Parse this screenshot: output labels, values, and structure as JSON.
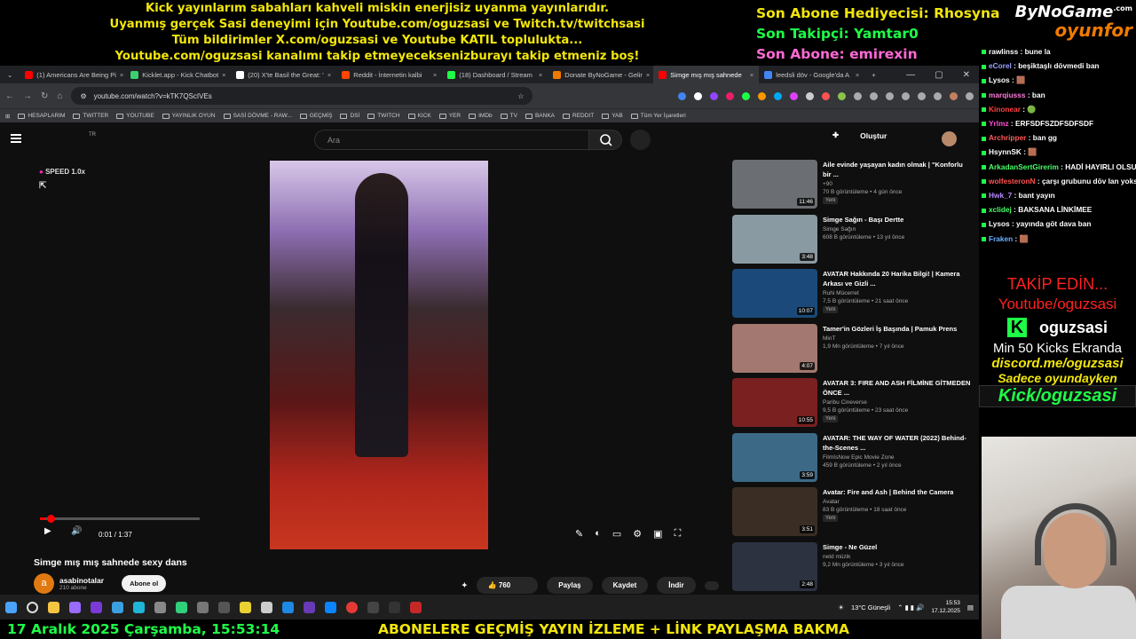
{
  "banner": {
    "line1": "Kick yayınlarım sabahları kahveli miskin enerjisiz uyanma yayınlarıdır.",
    "line2": "Uyanmış gerçek Sasi deneyimi için Youtube.com/oguzsasi ve Twitch.tv/twitchsasi",
    "line3": "Tüm bildirimler X.com/oguzsasi ve Youtube KATIL toplulukta...",
    "line4": "Youtube.com/oguzsasi kanalımı takip etmeyeceksenizburayı takip etmeniz boş!"
  },
  "stats": {
    "gift": "Son Abone Hediyecisi: Rhosyna",
    "follower": "Son Takipçi: Yamtar0",
    "subscriber": "Son Abone: emirexin"
  },
  "brand": {
    "name": "ByNoGame",
    "com": ".com",
    "sub": "oyunfor"
  },
  "tabs": [
    {
      "label": "(1) Americans Are Being Pi",
      "color": "#ff0000"
    },
    {
      "label": "Kicklet.app - Kick Chatbot",
      "color": "#3bd16f"
    },
    {
      "label": "(20) X'te Basil the Great: '",
      "color": "#ffffff"
    },
    {
      "label": "Reddit - İnternetin kalbi",
      "color": "#ff4500"
    },
    {
      "label": "(18) Dashboard / Stream",
      "color": "#1eff47"
    },
    {
      "label": "Donate ByNoGame - Gelir",
      "color": "#f07a00"
    },
    {
      "label": "Simge mış mış sahnede",
      "color": "#ff0000",
      "active": true
    },
    {
      "label": "leedsli döv - Google'da A",
      "color": "#4285f4"
    }
  ],
  "address": {
    "url": "youtube.com/watch?v=kTK7QScIVEs"
  },
  "bookmarks": [
    "HESAPLARIM",
    "TWITTER",
    "YOUTUBE",
    "YAYINLIK OYUN",
    "SASİ DÖVME - RAW...",
    "GEÇMİŞ",
    "DSİ",
    "TWITCH",
    "KICK",
    "YER",
    "IMDb",
    "TV",
    "BANKA",
    "REDDIT",
    "YAB",
    "Tüm Yer İşaretleri"
  ],
  "youtube": {
    "region": "TR",
    "search_placeholder": "Ara",
    "create_label": "Oluştur",
    "speed": "SPEED 1.0x",
    "time": "0:01 / 1:37",
    "progress": 0.01,
    "title": "Simge mış mış sahnede sexy dans",
    "channel": "asabinotalar",
    "channel_initial": "a",
    "subscribers": "210 abone",
    "subscribe_label": "Abone ol",
    "likes": "760",
    "share": "Paylaş",
    "save": "Kaydet",
    "download": "İndir"
  },
  "recommendations": [
    {
      "title": "Aile evinde yaşayan kadın olmak | \"Konforlu bir ...",
      "channel": "+90",
      "views": "70 B görüntüleme • 4 gün önce",
      "badge": "Yeni",
      "duration": "11:46",
      "color": "#6b6e72"
    },
    {
      "title": "Simge Sağın - Başı Dertte",
      "channel": "Simge Sağın",
      "views": "608 B görüntüleme • 13 yıl önce",
      "badge": "",
      "duration": "3:48",
      "color": "#8a9aa2"
    },
    {
      "title": "AVATAR Hakkında 20 Harika Bilgi! | Kamera Arkası ve Gizli ...",
      "channel": "Ruhi Mücerret",
      "views": "7,5 B görüntüleme • 21 saat önce",
      "badge": "Yeni",
      "duration": "10:07",
      "color": "#1b4a7a"
    },
    {
      "title": "Tamer'in Gözleri İş Başında | Pamuk Prens",
      "channel": "MinT",
      "views": "1,9 Mn görüntüleme • 7 yıl önce",
      "badge": "",
      "duration": "4:07",
      "color": "#a37870"
    },
    {
      "title": "AVATAR 3: FIRE AND ASH FİLMİNE GİTMEDEN ÖNCE ...",
      "channel": "Paribu Cineverse",
      "views": "9,5 B görüntüleme • 23 saat önce",
      "badge": "Yeni",
      "duration": "10:55",
      "color": "#7a2020"
    },
    {
      "title": "AVATAR: THE WAY OF WATER (2022) Behind-the-Scenes ...",
      "channel": "FilmIsNow Epic Movie Zone",
      "views": "459 B görüntüleme • 2 yıl önce",
      "badge": "",
      "duration": "3:59",
      "color": "#3c6a86"
    },
    {
      "title": "Avatar: Fire and Ash | Behind the Camera",
      "channel": "Avatar",
      "views": "83 B görüntüleme • 18 saat önce",
      "badge": "Yeni",
      "duration": "3:51",
      "color": "#3a2e24"
    },
    {
      "title": "Simge - Ne Güzel",
      "channel": "netd müzik",
      "views": "9,2 Mn görüntüleme • 3 yıl önce",
      "badge": "",
      "duration": "2:48",
      "color": "#2c3240"
    }
  ],
  "chat": [
    {
      "user": "rawlinss",
      "msg": "bune la",
      "color": "#ffffff"
    },
    {
      "user": "eCorel",
      "msg": "beşiktaşlı dövmedi ban",
      "color": "#9aa0ff"
    },
    {
      "user": "Lysos",
      "msg": "🟫",
      "color": "#ffffff"
    },
    {
      "user": "marqiusss",
      "msg": "ban",
      "color": "#ff7ad9"
    },
    {
      "user": "Kinonear",
      "msg": "🟢",
      "color": "#ff4040"
    },
    {
      "user": "Yrlmz",
      "msg": "ERFSDFSZDFSDFSDF",
      "color": "#ff4fd8"
    },
    {
      "user": "Archripper",
      "msg": "ban gg",
      "color": "#ff5a5a"
    },
    {
      "user": "HsynnSK",
      "msg": "🟫",
      "color": "#ffffff"
    },
    {
      "user": "ArkadanSertGirerim",
      "msg": "HADİ HAYIRLI OLSUN",
      "color": "#4cff6a"
    },
    {
      "user": "wolfesteronN",
      "msg": "çarşı grubunu döv lan yoksa ban banlarım",
      "color": "#ff5050"
    },
    {
      "user": "Hwk_7",
      "msg": "bant yayın",
      "color": "#b78aff"
    },
    {
      "user": "xclidej",
      "msg": "BAKSANA LİNKİMEE",
      "color": "#4cff6a"
    },
    {
      "user": "Lysos",
      "msg": "yayında göt dava ban",
      "color": "#ffffff"
    },
    {
      "user": "Fraken",
      "msg": "🟫",
      "color": "#6ab0ff"
    }
  ],
  "promo": {
    "follow": "TAKİP EDİN...",
    "youtube": "Youtube/oguzsasi",
    "kick_name": "oguzsasi",
    "kicks": "Min 50 Kicks Ekranda",
    "discord": "discord.me/oguzsasi",
    "only_game": "Sadece oyundayken",
    "kick_link": "Kick/oguzsasi"
  },
  "taskbar": {
    "weather": "13°C  Güneşli",
    "time": "15:53",
    "date": "17.12.2025"
  },
  "bottom": {
    "date": "17 Aralık 2025 Çarşamba, 15:53:14",
    "ticker": "ABONELERE GEÇMİŞ YAYIN İZLEME + LİNK PAYLAŞMA BAKMA"
  }
}
